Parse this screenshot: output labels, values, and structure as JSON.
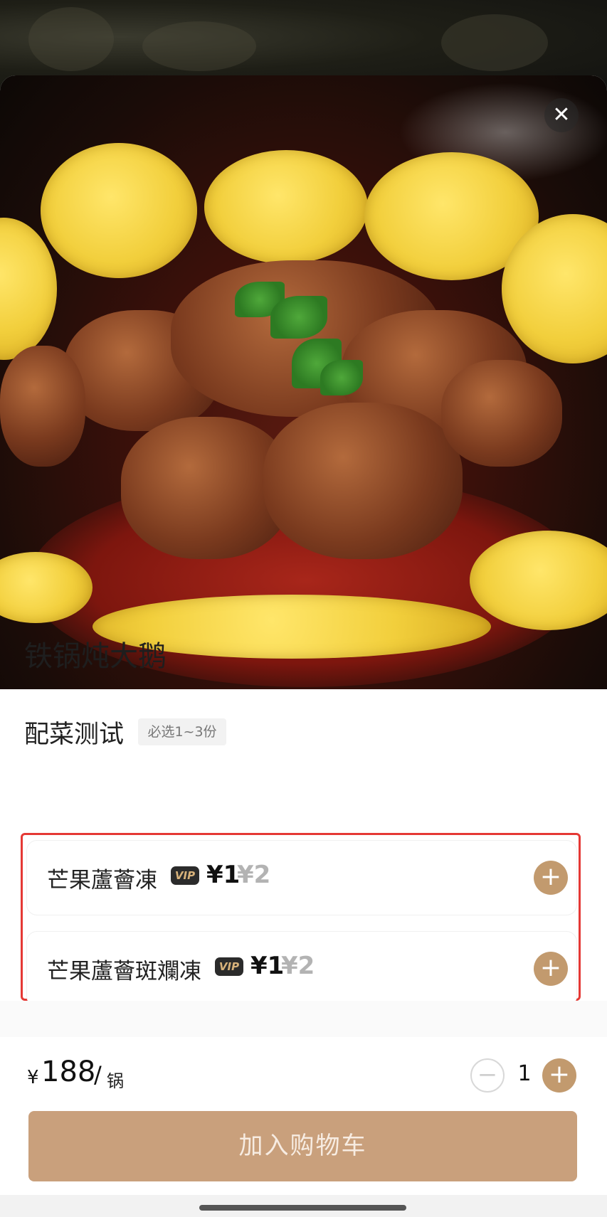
{
  "dish": {
    "title": "铁锅炖大鹅",
    "close_icon": "close-icon",
    "image_alt_icon": "food-photo"
  },
  "side_group": {
    "title": "配菜测试",
    "requirement": "必选1~3份",
    "options": [
      {
        "name": "芒果蘆薈凍",
        "vip_badge": "VIP",
        "price_now": "¥1",
        "price_old": "¥2"
      },
      {
        "name": "芒果蘆薈斑斕凍",
        "vip_badge": "VIP",
        "price_now": "¥1",
        "price_old": "¥2"
      }
    ]
  },
  "footer": {
    "currency": "¥",
    "price": "188",
    "separator": "/",
    "unit": "锅",
    "quantity": "1",
    "minus_symbol": "−",
    "plus_symbol": "+",
    "add_to_cart": "加入购物车"
  },
  "colors": {
    "accent": "#c29a6e",
    "cart_button": "#c9a07c",
    "highlight_frame": "#e53935"
  }
}
